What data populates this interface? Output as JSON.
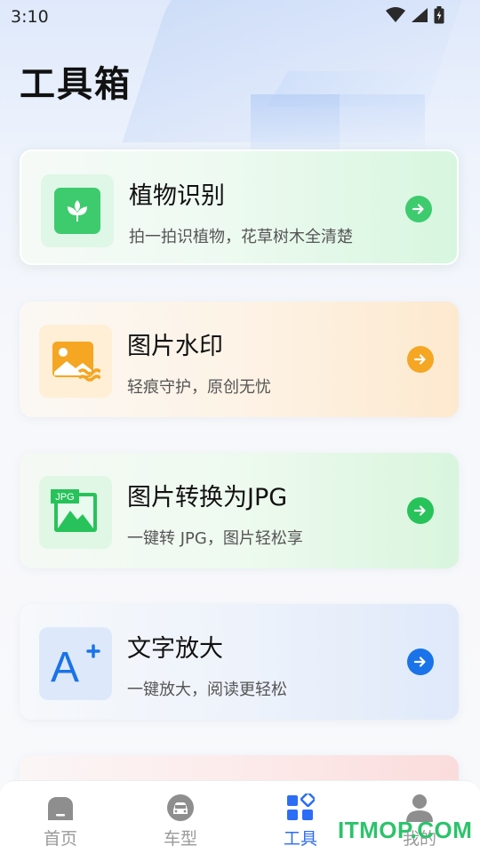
{
  "status_bar": {
    "time": "3:10"
  },
  "page": {
    "title": "工具箱"
  },
  "cards": [
    {
      "title": "植物识别",
      "description": "拍一拍识植物，花草树木全清楚",
      "icon": "plant-icon",
      "accent": "#3ecb6e"
    },
    {
      "title": "图片水印",
      "description": "轻痕守护，原创无忧",
      "icon": "image-watermark-icon",
      "accent": "#f5a623"
    },
    {
      "title": "图片转换为JPG",
      "description": "一键转 JPG，图片轻松享",
      "icon": "jpg-convert-icon",
      "accent": "#27c35a",
      "badge": "JPG"
    },
    {
      "title": "文字放大",
      "description": "一键放大，阅读更轻松",
      "icon": "text-enlarge-icon",
      "accent": "#1a73e8",
      "glyph": "A"
    }
  ],
  "tabs": [
    {
      "label": "首页",
      "icon": "home-icon"
    },
    {
      "label": "车型",
      "icon": "car-icon"
    },
    {
      "label": "工具",
      "icon": "tools-icon",
      "active": true
    },
    {
      "label": "我的",
      "icon": "user-icon"
    }
  ],
  "watermark": "ITMOP.COM"
}
